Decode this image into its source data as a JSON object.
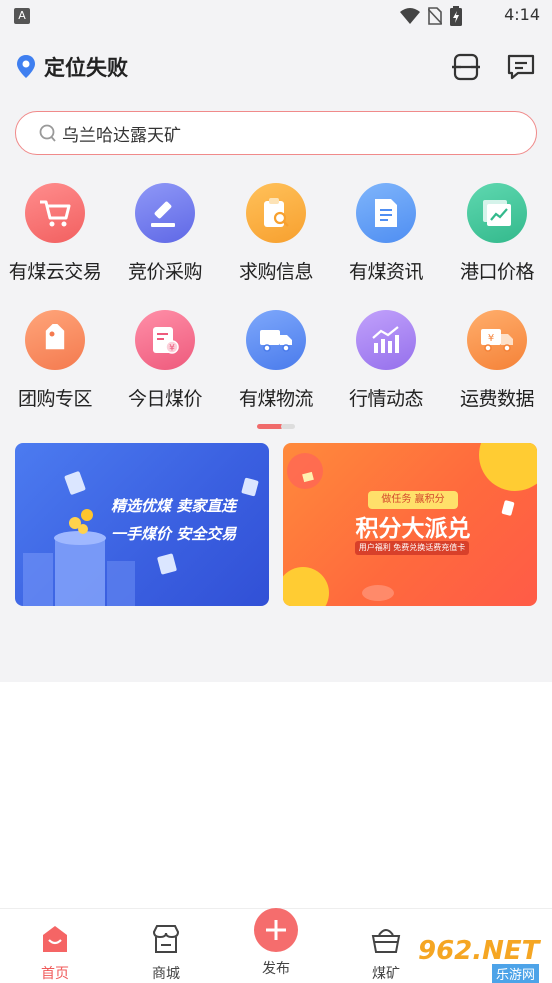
{
  "status_bar": {
    "time": "4:14",
    "notification_letter": "A"
  },
  "header": {
    "location": "定位失败"
  },
  "search": {
    "placeholder": "乌兰哈达露天矿"
  },
  "grid": {
    "row1": [
      {
        "label": "有煤云交易",
        "icon": "cart-icon",
        "color": "#f76a6a"
      },
      {
        "label": "竞价采购",
        "icon": "gavel-icon",
        "color": "#6e7bf2"
      },
      {
        "label": "求购信息",
        "icon": "clipboard-search-icon",
        "color": "#f9a83a"
      },
      {
        "label": "有煤资讯",
        "icon": "document-icon",
        "color": "#5a9bf5"
      },
      {
        "label": "港口价格",
        "icon": "chart-frame-icon",
        "color": "#3cc59a"
      }
    ],
    "row2": [
      {
        "label": "团购专区",
        "icon": "tag-icon",
        "color": "#f8845a"
      },
      {
        "label": "今日煤价",
        "icon": "price-doc-icon",
        "color": "#f26b8a"
      },
      {
        "label": "有煤物流",
        "icon": "truck-icon",
        "color": "#5a8af5"
      },
      {
        "label": "行情动态",
        "icon": "trend-icon",
        "color": "#a77ff0"
      },
      {
        "label": "运费数据",
        "icon": "freight-truck-icon",
        "color": "#f88a4a"
      }
    ]
  },
  "banners": {
    "left": {
      "line1": "精选优煤  卖家直连",
      "line2": "一手煤价  安全交易"
    },
    "right": {
      "badge": "做任务  赢积分",
      "title": "积分大派兑",
      "subtitle": "用户福利 免费兑换话费充值卡"
    }
  },
  "tabbar": {
    "home": "首页",
    "mall": "商城",
    "publish": "发布",
    "mine": "煤矿"
  },
  "watermark": {
    "text": "962.NET",
    "sub": "乐游网"
  }
}
